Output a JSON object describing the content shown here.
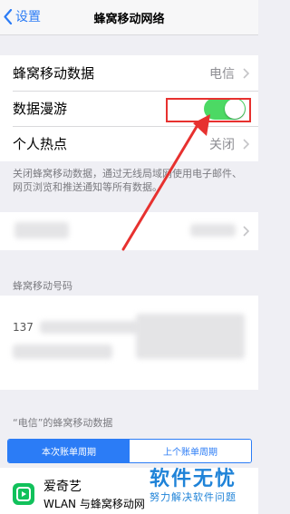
{
  "nav": {
    "back_label": "设置",
    "title": "蜂窝移动网络"
  },
  "rows": {
    "cellular_data": {
      "label": "蜂窝移动数据",
      "value": "电信"
    },
    "data_roaming": {
      "label": "数据漫游",
      "on": true
    },
    "hotspot": {
      "label": "个人热点",
      "value": "关闭"
    }
  },
  "footer_note": "关闭蜂窝移动数据，通过无线局域网使用电子邮件、网页浏览和推送通知等所有数据。",
  "cellular_number_header": "蜂窝移动号码",
  "masked_number": "137",
  "usage_header": "“电信”的蜂窝移动数据",
  "segments": [
    "本次账单周期",
    "上个账单周期"
  ],
  "app": {
    "name": "爱奇艺",
    "sub": "WLAN 与蜂窝移动网"
  },
  "watermark": {
    "main": "软件无忧",
    "sub": "努力解决软件问题"
  },
  "colors": {
    "accent": "#2b7cf6",
    "toggle_on": "#4cd964",
    "annotation": "#e7312f"
  }
}
